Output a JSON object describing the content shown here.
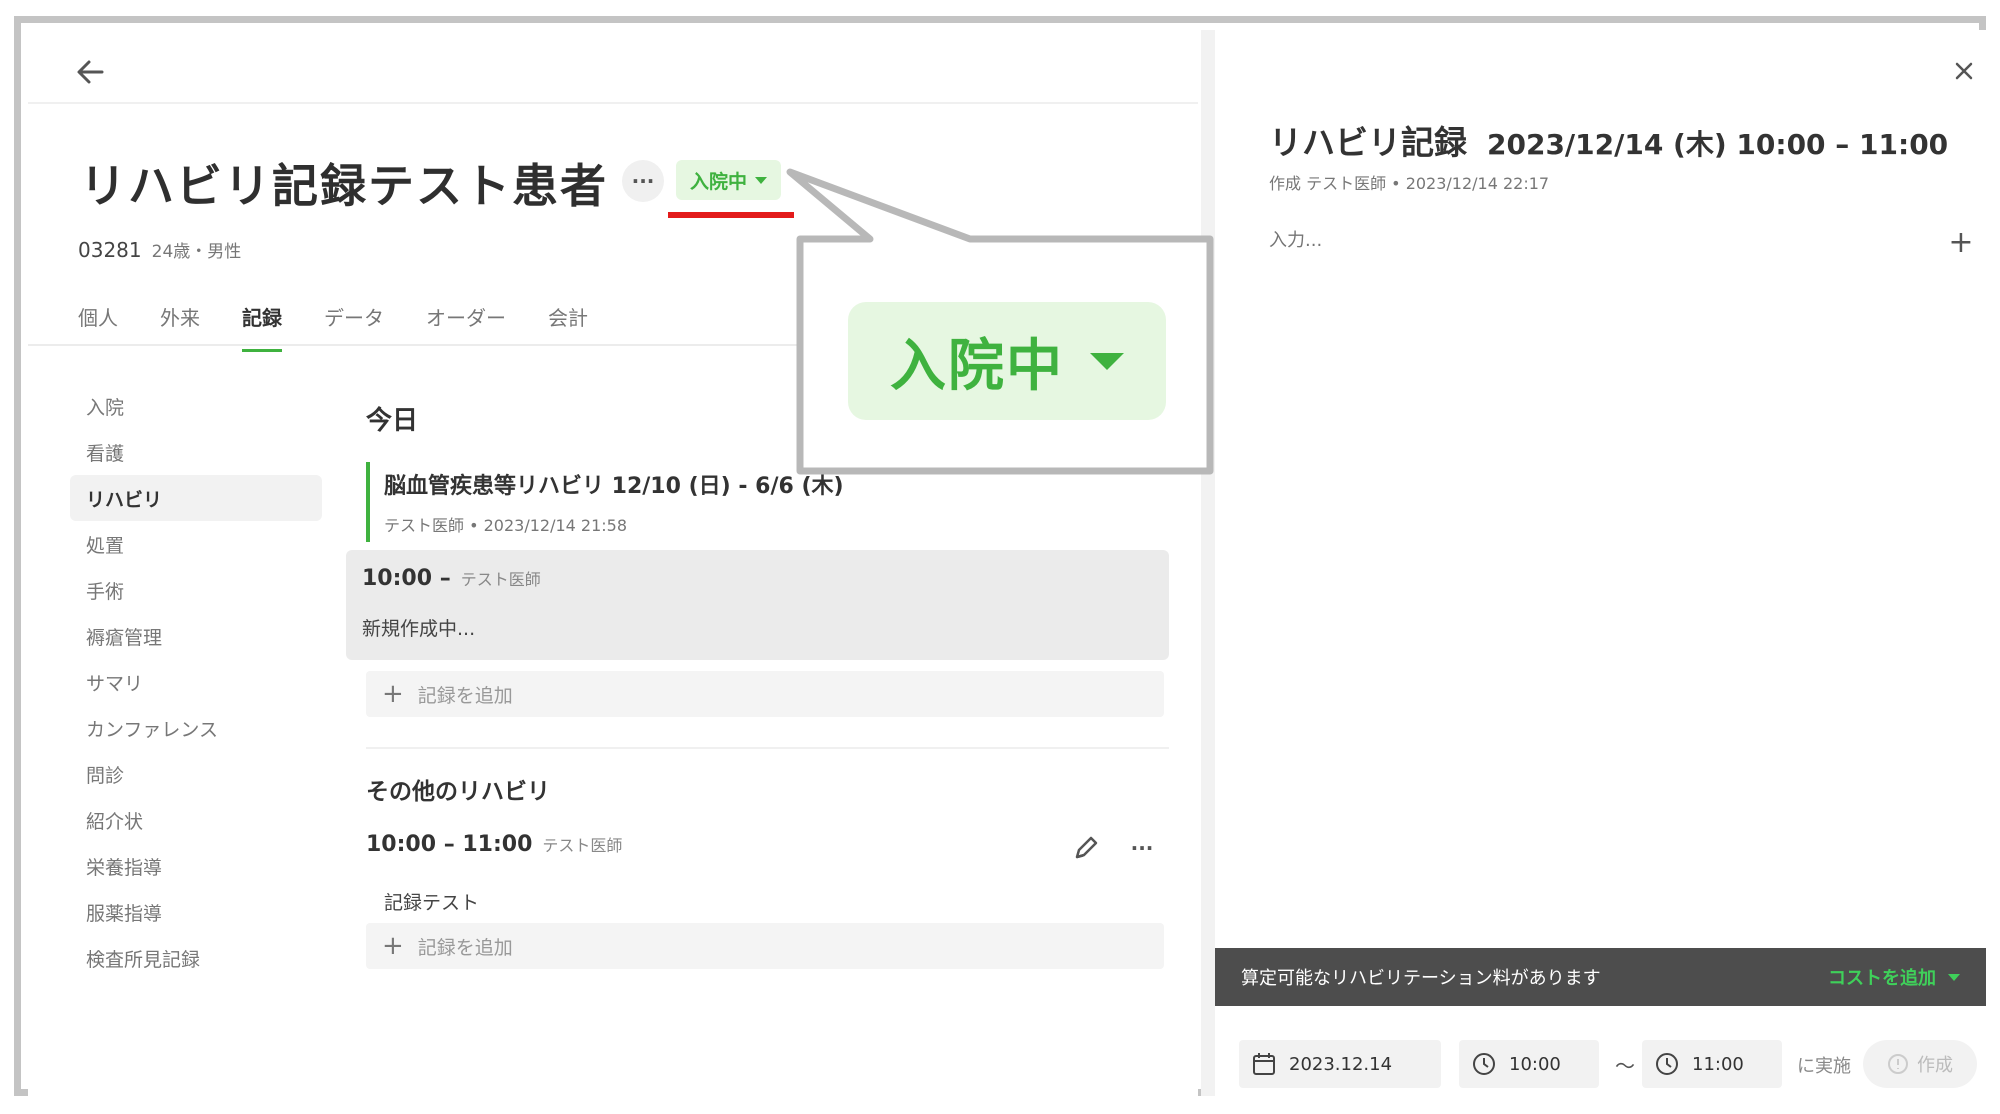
{
  "patient": {
    "name": "リハビリ記録テスト患者",
    "status": "入院中",
    "id": "03281",
    "age_sex": "24歳・男性"
  },
  "tabs": [
    "個人",
    "外来",
    "記録",
    "データ",
    "オーダー",
    "会計"
  ],
  "active_tab": "記録",
  "sidenav": [
    "入院",
    "看護",
    "リハビリ",
    "処置",
    "手術",
    "褥瘡管理",
    "サマリ",
    "カンファレンス",
    "問診",
    "紹介状",
    "栄養指導",
    "服薬指導",
    "検査所見記録"
  ],
  "active_nav": "リハビリ",
  "today": {
    "title": "今日",
    "plan_title": "脳血管疾患等リハビリ 12/10 (日) - 6/6 (木)",
    "plan_meta": "テスト医師 • 2023/12/14 21:58",
    "draft_time": "10:00 –",
    "draft_author": "テスト医師",
    "draft_body": "新規作成中...",
    "add_label": "記録を追加"
  },
  "other": {
    "title": "その他のリハビリ",
    "time": "10:00 – 11:00",
    "author": "テスト医師",
    "body": "記録テスト",
    "add_label": "記録を追加"
  },
  "panel": {
    "title": "リハビリ記録",
    "datetime": "2023/12/14 (木) 10:00 – 11:00",
    "meta": "作成 テスト医師 • 2023/12/14 22:17",
    "input_placeholder": "入力...",
    "cost_message": "算定可能なリハビリテーション料があります",
    "cost_button": "コストを追加",
    "date": "2023.12.14",
    "start": "10:00",
    "tilde": "～",
    "end": "11:00",
    "jisshi": "に実施",
    "create": "作成"
  },
  "callout": {
    "label": "入院中"
  },
  "colors": {
    "accent_green": "#3fb23f",
    "chip_bg": "#e6f7e1",
    "highlight_red": "#e31b1b",
    "cost_bar": "#4d4d4d"
  }
}
